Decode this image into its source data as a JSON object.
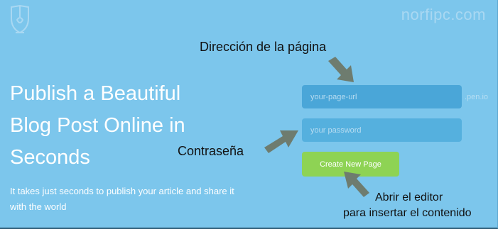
{
  "watermark": "norfipc.com",
  "icons": {
    "logo": "fountain-pen-nib-icon"
  },
  "hero": {
    "headline": "Publish a Beautiful Blog Post Online in Seconds",
    "subtext": "It takes just seconds to publish your article and share it with the world"
  },
  "form": {
    "url_placeholder": "your-page-url",
    "url_suffix": ".pen.io",
    "password_placeholder": "your password",
    "create_button_label": "Create New Page"
  },
  "annotations": {
    "page_address": "Dirección de la página",
    "password": "Contraseña",
    "open_editor_line1": "Abrir el editor",
    "open_editor_line2": "para insertar el contenido"
  },
  "colors": {
    "background": "#7cc6ec",
    "input_fill": "#4aa6d8",
    "button_green": "#8ed354",
    "arrow_gray": "#6e7c6f"
  }
}
